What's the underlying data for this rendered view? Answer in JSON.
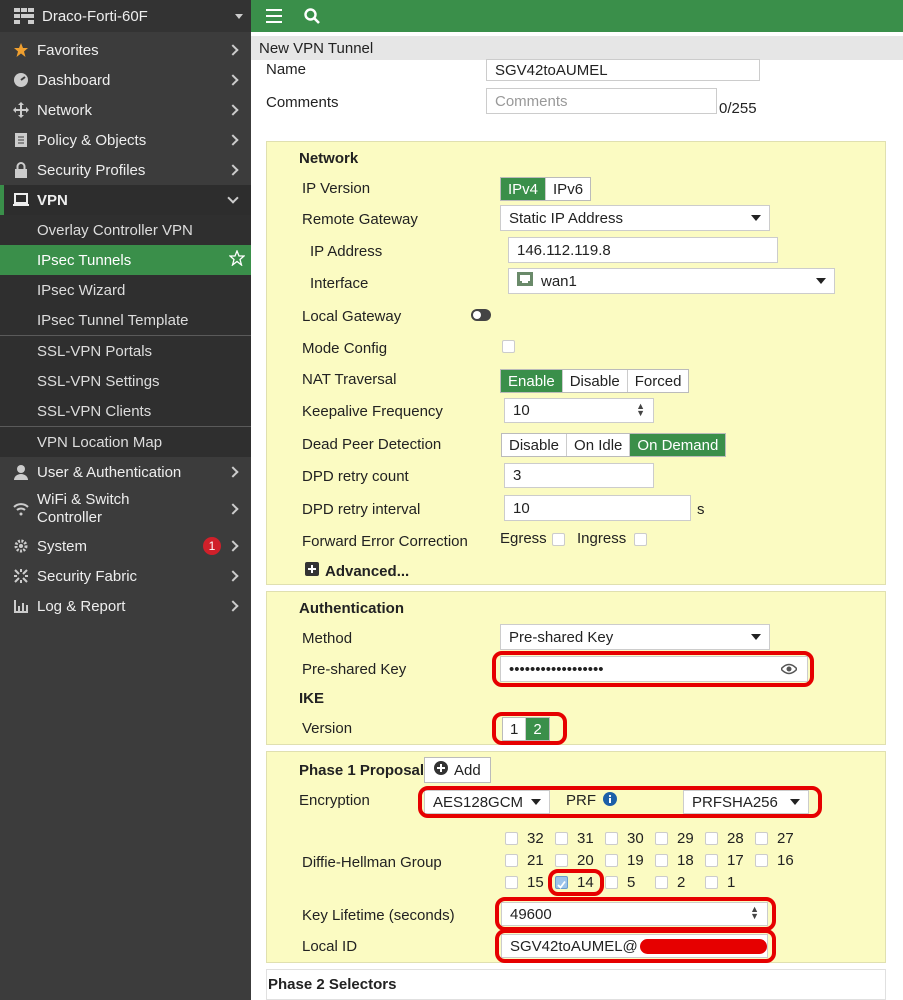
{
  "device": {
    "name": "Draco-Forti-60F"
  },
  "sidebar": {
    "items": [
      {
        "label": "Favorites"
      },
      {
        "label": "Dashboard"
      },
      {
        "label": "Network"
      },
      {
        "label": "Policy & Objects"
      },
      {
        "label": "Security Profiles"
      },
      {
        "label": "VPN"
      },
      {
        "label": "User & Authentication"
      },
      {
        "label": "WiFi & Switch Controller"
      },
      {
        "label": "System",
        "badge": "1"
      },
      {
        "label": "Security Fabric"
      },
      {
        "label": "Log & Report"
      }
    ],
    "vpn_sub": [
      {
        "label": "Overlay Controller VPN"
      },
      {
        "label": "IPsec Tunnels"
      },
      {
        "label": "IPsec Wizard"
      },
      {
        "label": "IPsec Tunnel Template"
      },
      {
        "label": "SSL-VPN Portals"
      },
      {
        "label": "SSL-VPN Settings"
      },
      {
        "label": "SSL-VPN Clients"
      },
      {
        "label": "VPN Location Map"
      }
    ],
    "wifi_line1": "WiFi & Switch",
    "wifi_line2": "Controller"
  },
  "page": {
    "title": "New VPN Tunnel",
    "name_label": "Name",
    "name_value": "SGV42toAUMEL",
    "comments_label": "Comments",
    "comments_placeholder": "Comments",
    "comments_count": "0/255"
  },
  "network": {
    "title": "Network",
    "ip_version_label": "IP Version",
    "ip_version_options": [
      "IPv4",
      "IPv6"
    ],
    "remote_gateway_label": "Remote Gateway",
    "remote_gateway_value": "Static IP Address",
    "ip_address_label": "IP Address",
    "ip_address_value": "146.112.119.8",
    "interface_label": "Interface",
    "interface_value": "wan1",
    "local_gateway_label": "Local Gateway",
    "mode_config_label": "Mode Config",
    "nat_traversal_label": "NAT Traversal",
    "nat_options": [
      "Enable",
      "Disable",
      "Forced"
    ],
    "keepalive_label": "Keepalive Frequency",
    "keepalive_value": "10",
    "dpd_label": "Dead Peer Detection",
    "dpd_options": [
      "Disable",
      "On Idle",
      "On Demand"
    ],
    "dpd_retry_count_label": "DPD retry count",
    "dpd_retry_count_value": "3",
    "dpd_retry_interval_label": "DPD retry interval",
    "dpd_retry_interval_value": "10",
    "dpd_retry_interval_unit": "s",
    "fec_label": "Forward Error Correction",
    "fec_egress": "Egress",
    "fec_ingress": "Ingress",
    "advanced_label": "Advanced..."
  },
  "authentication": {
    "title": "Authentication",
    "method_label": "Method",
    "method_value": "Pre-shared Key",
    "psk_label": "Pre-shared Key",
    "psk_value": "••••••••••••••••••",
    "ike_title": "IKE",
    "version_label": "Version",
    "version_options": [
      "1",
      "2"
    ]
  },
  "phase1": {
    "title": "Phase 1 Proposal",
    "add_label": "Add",
    "encryption_label": "Encryption",
    "encryption_value": "AES128GCM",
    "prf_label": "PRF",
    "prf_value": "PRFSHA256",
    "dh_label": "Diffie-Hellman Group",
    "dh_groups": [
      "32",
      "31",
      "30",
      "29",
      "28",
      "27",
      "21",
      "20",
      "19",
      "18",
      "17",
      "16",
      "15",
      "14",
      "5",
      "2",
      "1"
    ],
    "key_lifetime_label": "Key Lifetime (seconds)",
    "key_lifetime_value": "49600",
    "local_id_label": "Local ID",
    "local_id_value": "SGV42toAUMEL@"
  },
  "phase2": {
    "title": "Phase 2 Selectors"
  },
  "colors": {
    "accent": "#3a8f4a",
    "panel": "#fbfbc2",
    "highlight": "#e60000",
    "sidebar": "#3c3c3c"
  }
}
